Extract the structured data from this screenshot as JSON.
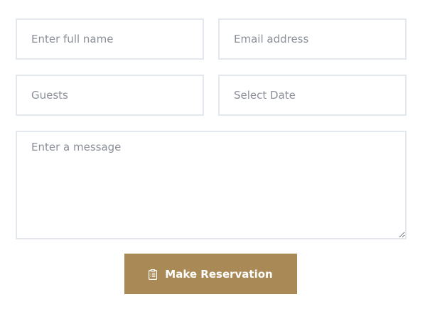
{
  "form": {
    "name_placeholder": "Enter full name",
    "email_placeholder": "Email address",
    "guests_placeholder": "Guests",
    "date_placeholder": "Select Date",
    "message_placeholder": "Enter a message",
    "submit_label": "Make Reservation",
    "submit_icon": "clipboard-list-icon"
  },
  "colors": {
    "button_bg": "#a98955",
    "border": "#e3e8ef",
    "placeholder": "#8a8f98"
  }
}
